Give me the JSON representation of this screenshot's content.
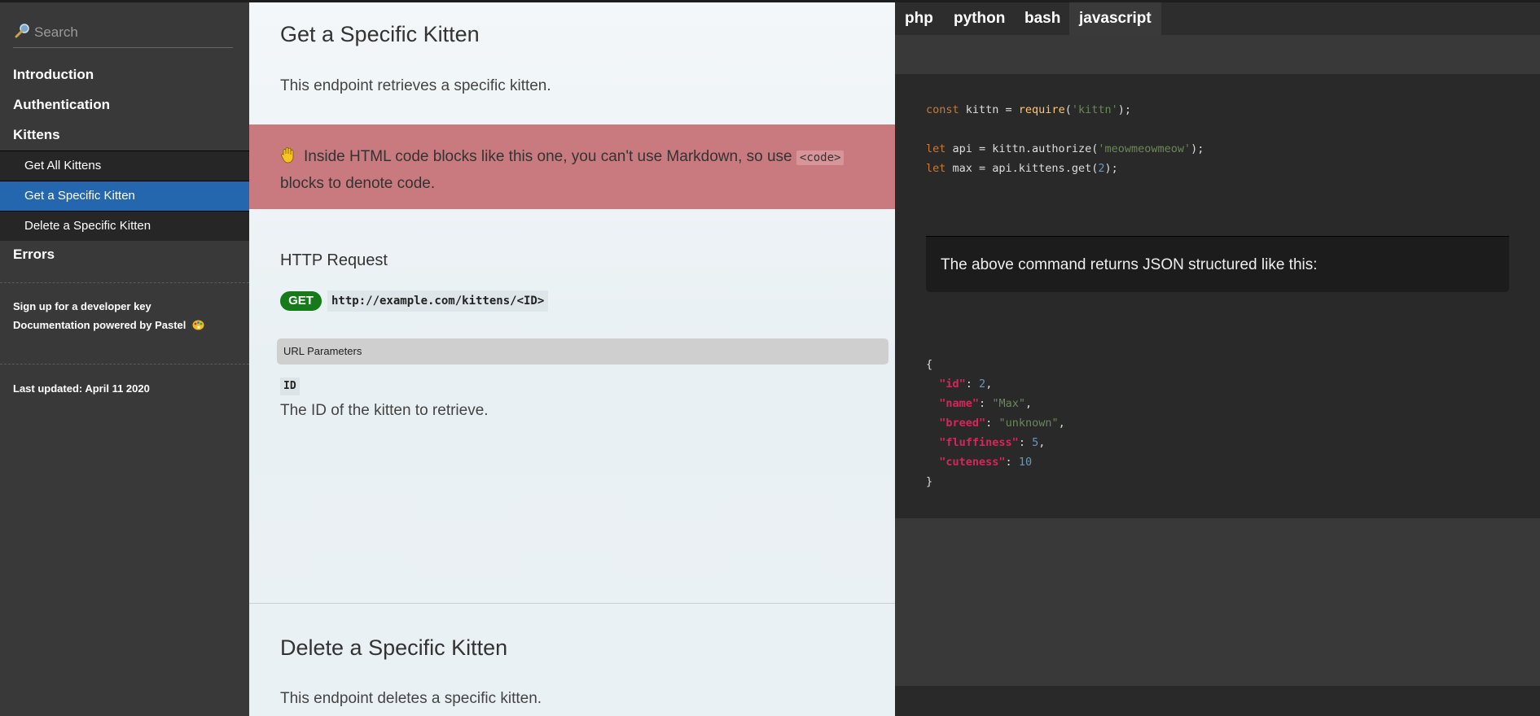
{
  "search": {
    "placeholder": "Search"
  },
  "toc": {
    "items": [
      {
        "label": "Introduction"
      },
      {
        "label": "Authentication"
      },
      {
        "label": "Kittens"
      },
      {
        "label": "Errors"
      }
    ],
    "subitems": [
      {
        "label": "Get All Kittens"
      },
      {
        "label": "Get a Specific Kitten",
        "active": true
      },
      {
        "label": "Delete a Specific Kitten"
      }
    ]
  },
  "footer": {
    "signup": "Sign up for a developer key",
    "powered": "Documentation powered by Pastel",
    "updated": "Last updated: April 11 2020"
  },
  "content": {
    "title": "Get a Specific Kitten",
    "intro": "This endpoint retrieves a specific kitten.",
    "warning_before": "Inside HTML code blocks like this one, you can't use Markdown, so use ",
    "warning_code": "<code>",
    "warning_after": " blocks to denote code.",
    "http_title": "HTTP Request",
    "method": "GET",
    "endpoint": "http://example.com/kittens/<ID>",
    "params_header": "URL Parameters",
    "param_name": "ID",
    "param_desc": "The ID of the kitten to retrieve.",
    "next_title": "Delete a Specific Kitten",
    "next_intro": "This endpoint deletes a specific kitten."
  },
  "code": {
    "tabs": [
      {
        "label": "php"
      },
      {
        "label": "python"
      },
      {
        "label": "bash"
      },
      {
        "label": "javascript",
        "active": true
      }
    ],
    "js": {
      "line1_kw": "const",
      "line1_var": " kittn = ",
      "line1_fn": "require",
      "line1_open": "(",
      "line1_str": "'kittn'",
      "line1_close": ");",
      "line2_kw": "let",
      "line2_rest": " api = kittn.authorize(",
      "line2_str": "'meowmeowmeow'",
      "line2_close": ");",
      "line3_kw": "let",
      "line3_rest": " max = api.kittens.get(",
      "line3_num": "2",
      "line3_close": ");"
    },
    "json_note": "The above command returns JSON structured like this:",
    "json": {
      "open": "{",
      "close": "}",
      "k1": "\"id\"",
      "v1": "2",
      "k2": "\"name\"",
      "v2": "\"Max\"",
      "k3": "\"breed\"",
      "v3": "\"unknown\"",
      "k4": "\"fluffiness\"",
      "v4": "5",
      "k5": "\"cuteness\"",
      "v5": "10"
    }
  }
}
